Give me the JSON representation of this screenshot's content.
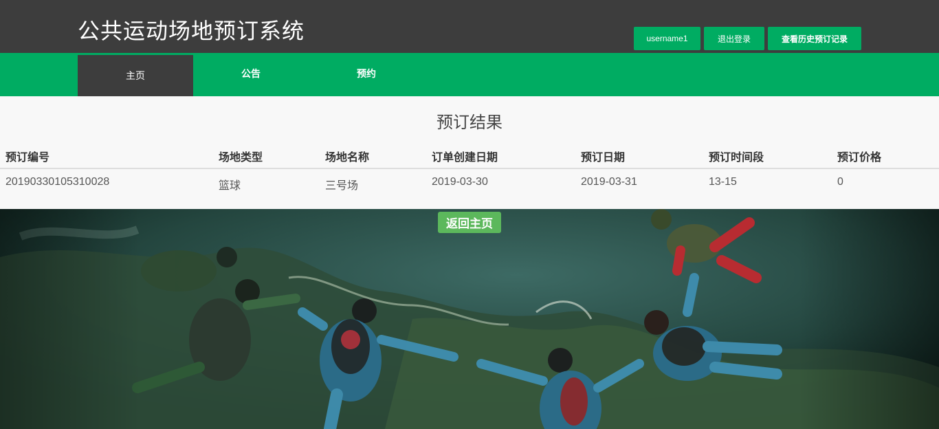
{
  "header": {
    "title": "公共运动场地预订系统",
    "username": "username1",
    "logout_label": "退出登录",
    "history_label": "查看历史预订记录"
  },
  "nav": {
    "home": "主页",
    "notice": "公告",
    "booking": "预约"
  },
  "result": {
    "title": "预订结果",
    "columns": [
      "预订编号",
      "场地类型",
      "场地名称",
      "订单创建日期",
      "预订日期",
      "预订时间段",
      "预订价格"
    ],
    "row": [
      "20190330105310028",
      "篮球",
      "三号场",
      "2019-03-30",
      "2019-03-31",
      "13-15",
      "0"
    ]
  },
  "back_label": "返回主页",
  "colors": {
    "header_bg": "#3d3d3d",
    "accent_green": "#00ac62",
    "back_button": "#5cb85c"
  }
}
